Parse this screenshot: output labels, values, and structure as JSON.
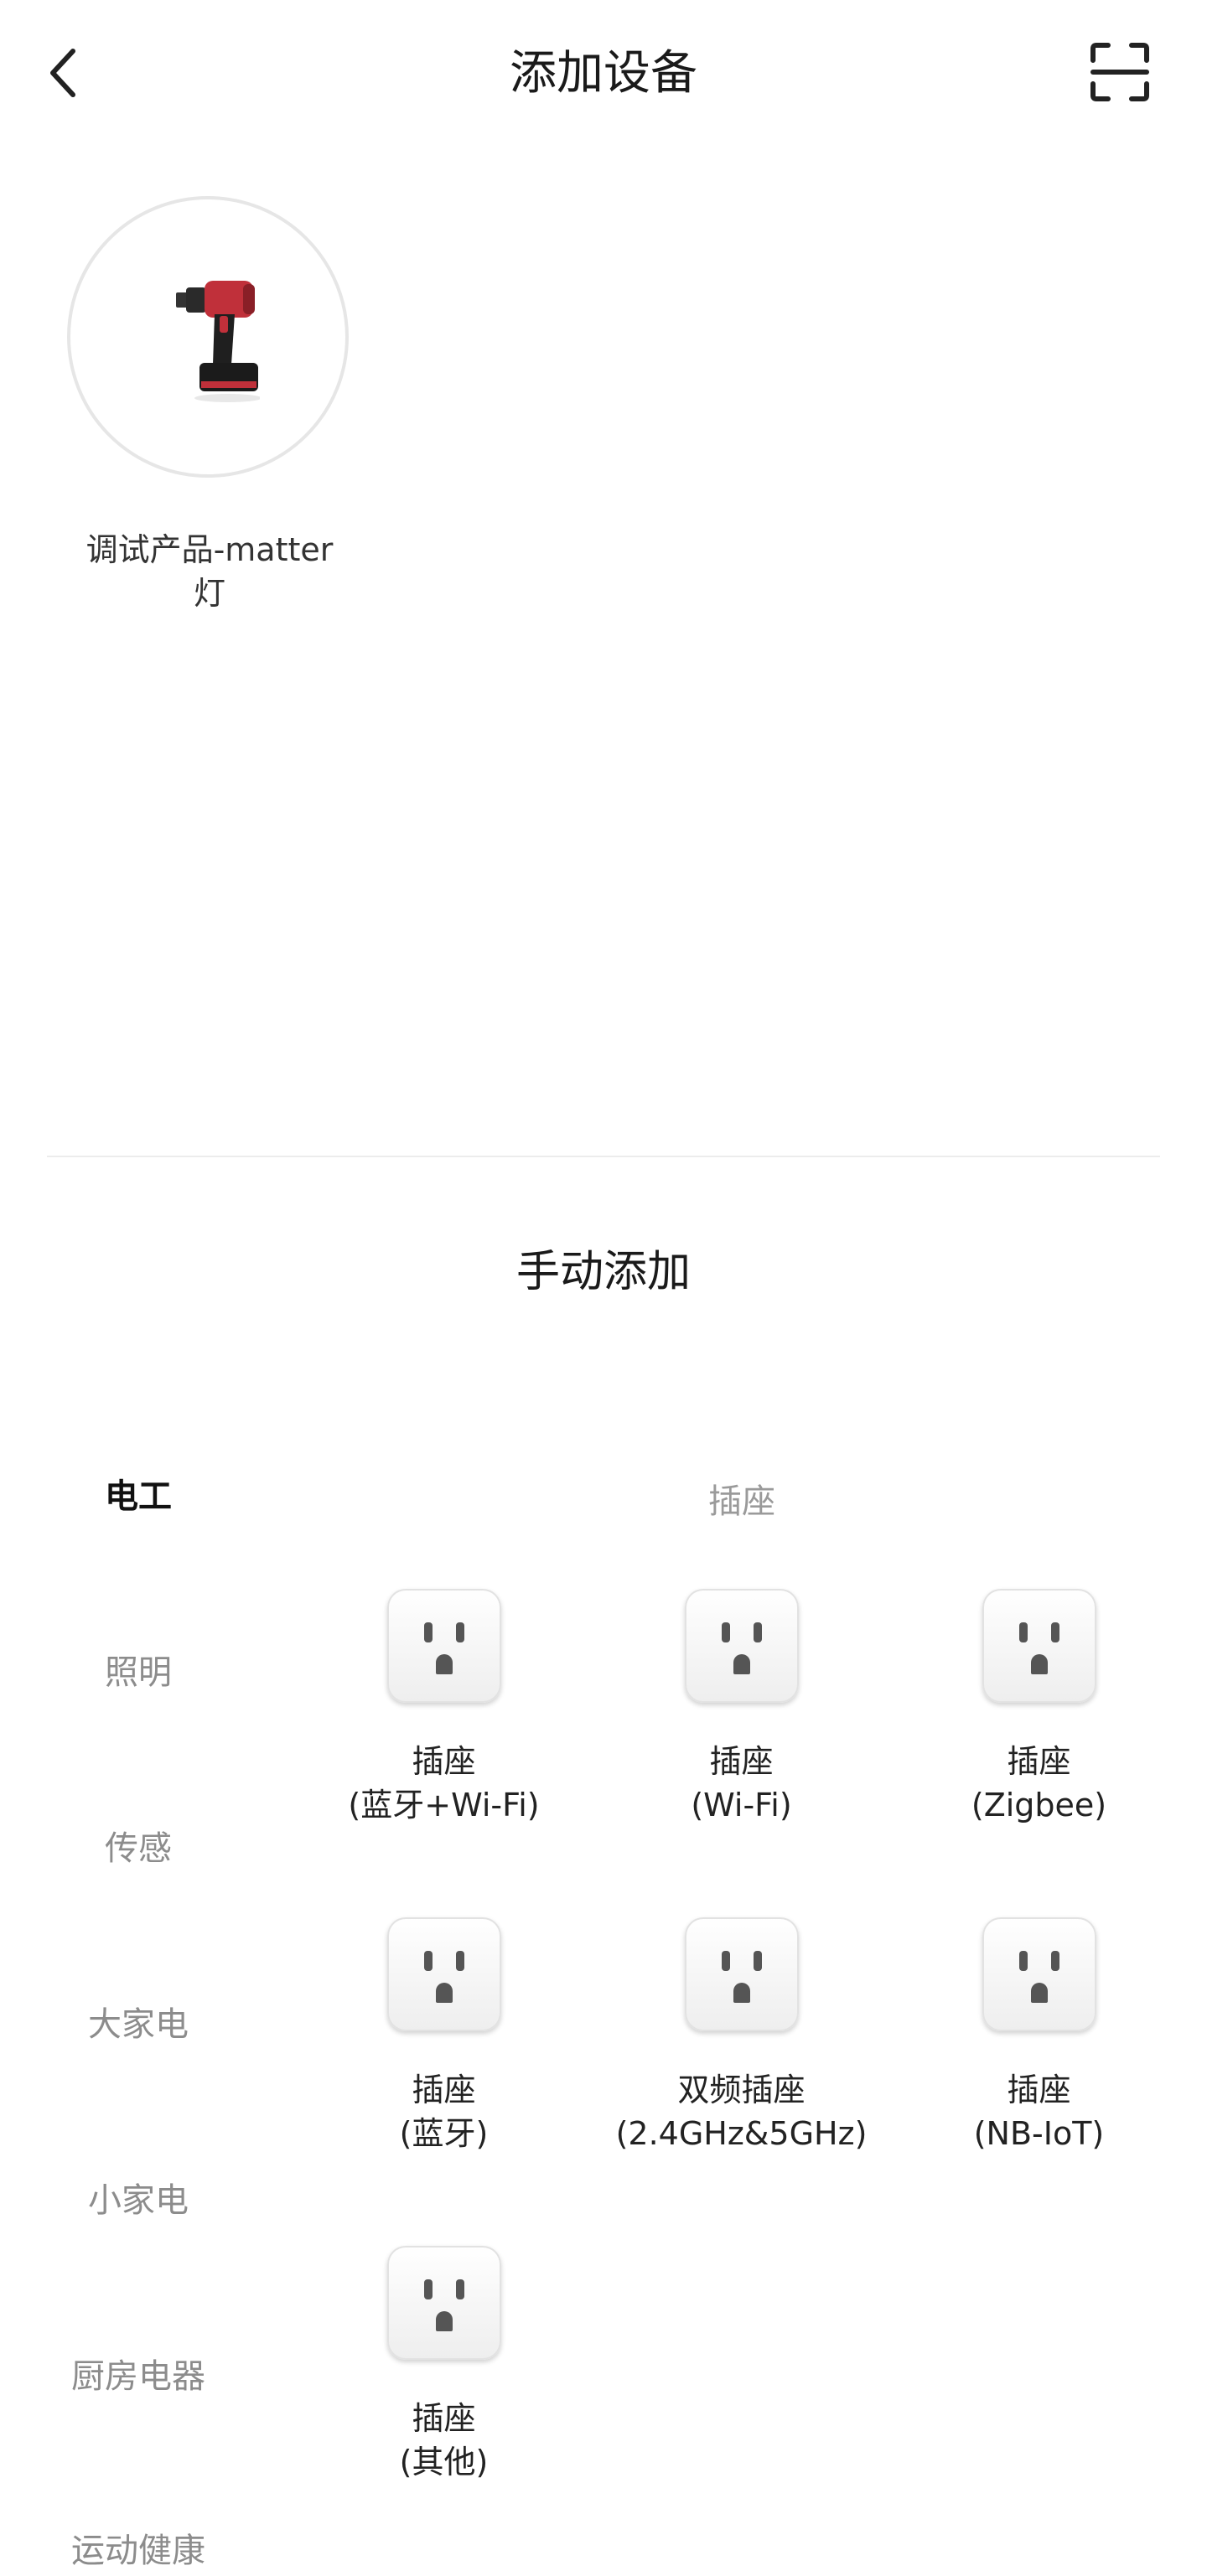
{
  "header": {
    "title": "添加设备",
    "back_icon": "chevron-left-icon",
    "scan_icon": "scan-frame-icon"
  },
  "discovered": {
    "devices": [
      {
        "name": "调试产品-matter\n灯",
        "icon": "power-drill-image"
      }
    ]
  },
  "manual": {
    "title": "手动添加",
    "categories": [
      {
        "label": "电工",
        "active": true
      },
      {
        "label": "照明"
      },
      {
        "label": "传感"
      },
      {
        "label": "大家电"
      },
      {
        "label": "小家电"
      },
      {
        "label": "厨房电器"
      },
      {
        "label": "运动健康"
      }
    ],
    "subcategory": "插座",
    "products": [
      {
        "label": "插座\n(蓝牙+Wi-Fi)"
      },
      {
        "label": "插座\n(Wi-Fi)"
      },
      {
        "label": "插座\n(Zigbee)"
      },
      {
        "label": "插座\n(蓝牙)"
      },
      {
        "label": "双频插座\n(2.4GHz&5GHz)"
      },
      {
        "label": "插座\n(NB-IoT)"
      },
      {
        "label": "插座\n(其他)"
      }
    ]
  },
  "colors": {
    "accent_text": "#111111",
    "muted_text": "#8c8c8c",
    "drill_red": "#c0303a"
  }
}
